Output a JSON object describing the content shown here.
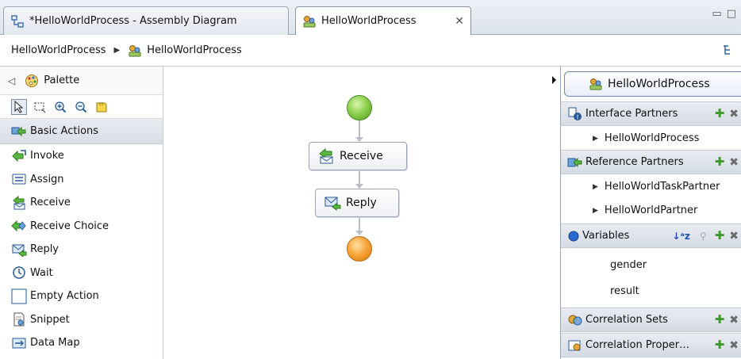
{
  "tabs": [
    {
      "label": "*HelloWorldProcess - Assembly Diagram",
      "icon": "assembly-diagram-icon"
    },
    {
      "label": "HelloWorldProcess",
      "icon": "process-icon",
      "close": "✕"
    }
  ],
  "breadcrumb": {
    "items": [
      "HelloWorldProcess",
      "HelloWorldProcess"
    ],
    "separator": "▶"
  },
  "palette": {
    "title": "Palette",
    "collapse": "◁",
    "drawer_label": "Basic Actions",
    "items": [
      {
        "label": "Invoke",
        "icon": "invoke-icon"
      },
      {
        "label": "Assign",
        "icon": "assign-icon"
      },
      {
        "label": "Receive",
        "icon": "receive-icon"
      },
      {
        "label": "Receive Choice",
        "icon": "receive-choice-icon"
      },
      {
        "label": "Reply",
        "icon": "reply-icon"
      },
      {
        "label": "Wait",
        "icon": "wait-icon"
      },
      {
        "label": "Empty Action",
        "icon": "empty-action-icon"
      },
      {
        "label": "Snippet",
        "icon": "snippet-icon"
      },
      {
        "label": "Data Map",
        "icon": "data-map-icon"
      }
    ]
  },
  "canvas": {
    "activities": [
      {
        "label": "Receive",
        "icon": "receive-icon"
      },
      {
        "label": "Reply",
        "icon": "reply-icon"
      }
    ]
  },
  "tray": {
    "title": "HelloWorldProcess",
    "sections": {
      "interface_partners": {
        "label": "Interface Partners",
        "items": [
          "HelloWorldProcess"
        ]
      },
      "reference_partners": {
        "label": "Reference Partners",
        "items": [
          "HelloWorldTaskPartner",
          "HelloWorldPartner"
        ]
      },
      "variables": {
        "label": "Variables",
        "items": [
          "gender",
          "result"
        ]
      },
      "correlation_sets": {
        "label": "Correlation Sets"
      },
      "correlation_properties": {
        "label": "Correlation Proper…"
      }
    }
  },
  "colors": {
    "start_node": "#8fd14f",
    "end_node": "#f7a73a",
    "add": "#3d9a2a",
    "accent": "#6f89b3"
  }
}
